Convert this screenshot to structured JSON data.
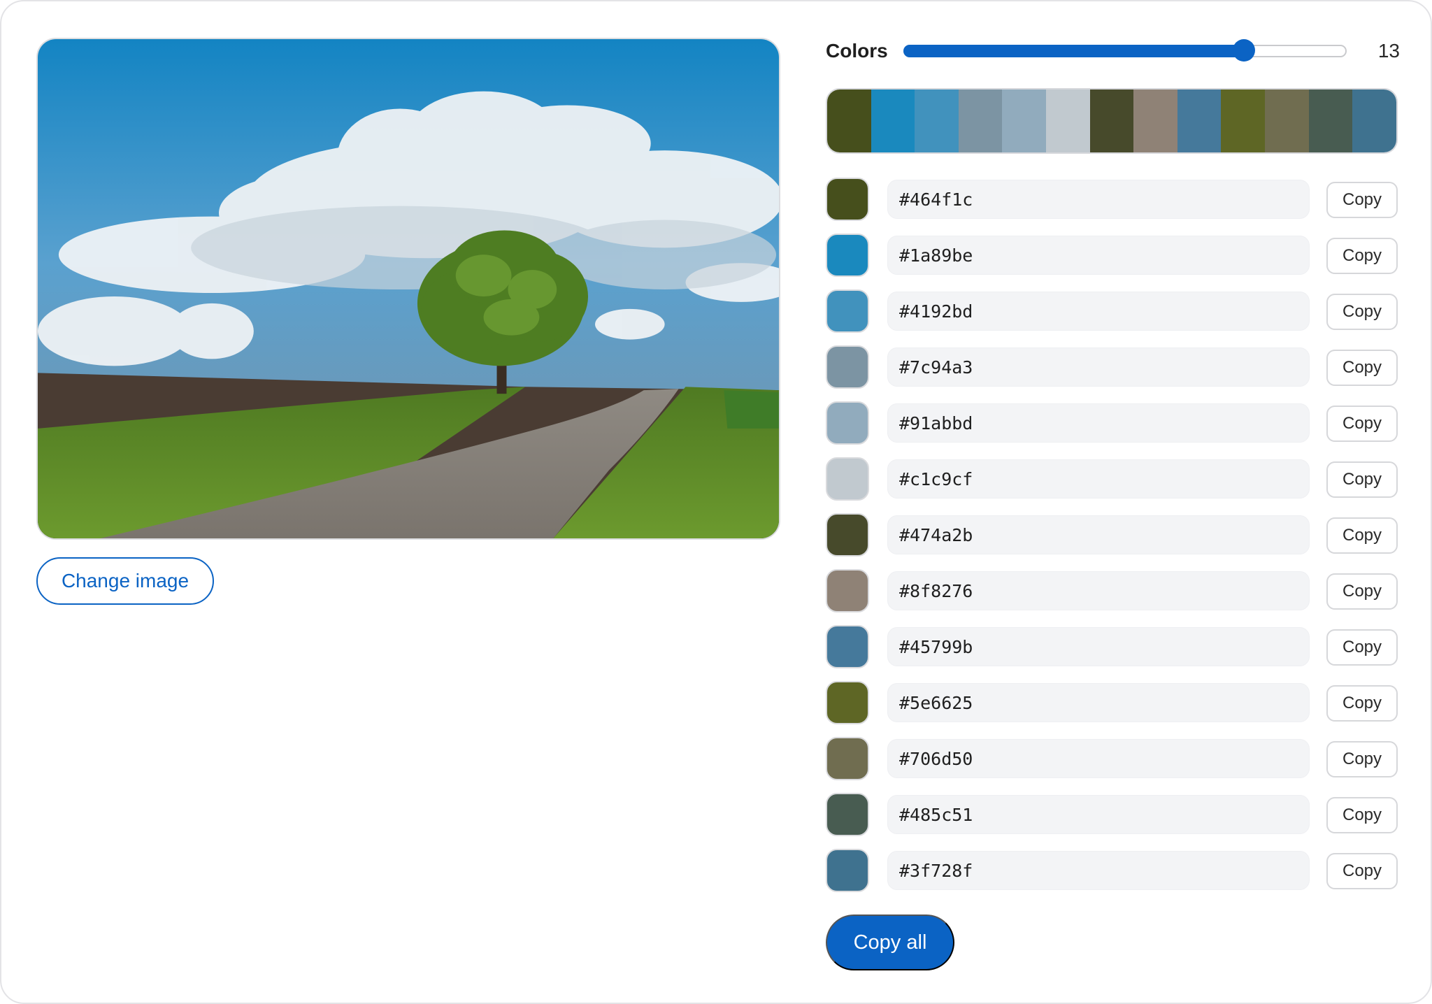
{
  "preview": {
    "image_alt": "Landscape photo of a lone green tree beside a winding road under a blue sky with white clouds"
  },
  "actions": {
    "change_image_label": "Change image",
    "copy_all_label": "Copy all"
  },
  "controls": {
    "colors_label": "Colors",
    "color_count": "13",
    "slider_fraction": 0.77
  },
  "palette": [
    {
      "hex": "#464f1c",
      "copy_label": "Copy"
    },
    {
      "hex": "#1a89be",
      "copy_label": "Copy"
    },
    {
      "hex": "#4192bd",
      "copy_label": "Copy"
    },
    {
      "hex": "#7c94a3",
      "copy_label": "Copy"
    },
    {
      "hex": "#91abbd",
      "copy_label": "Copy"
    },
    {
      "hex": "#c1c9cf",
      "copy_label": "Copy"
    },
    {
      "hex": "#474a2b",
      "copy_label": "Copy"
    },
    {
      "hex": "#8f8276",
      "copy_label": "Copy"
    },
    {
      "hex": "#45799b",
      "copy_label": "Copy"
    },
    {
      "hex": "#5e6625",
      "copy_label": "Copy"
    },
    {
      "hex": "#706d50",
      "copy_label": "Copy"
    },
    {
      "hex": "#485c51",
      "copy_label": "Copy"
    },
    {
      "hex": "#3f728f",
      "copy_label": "Copy"
    }
  ],
  "colors": {
    "accent": "#0b63c4"
  }
}
